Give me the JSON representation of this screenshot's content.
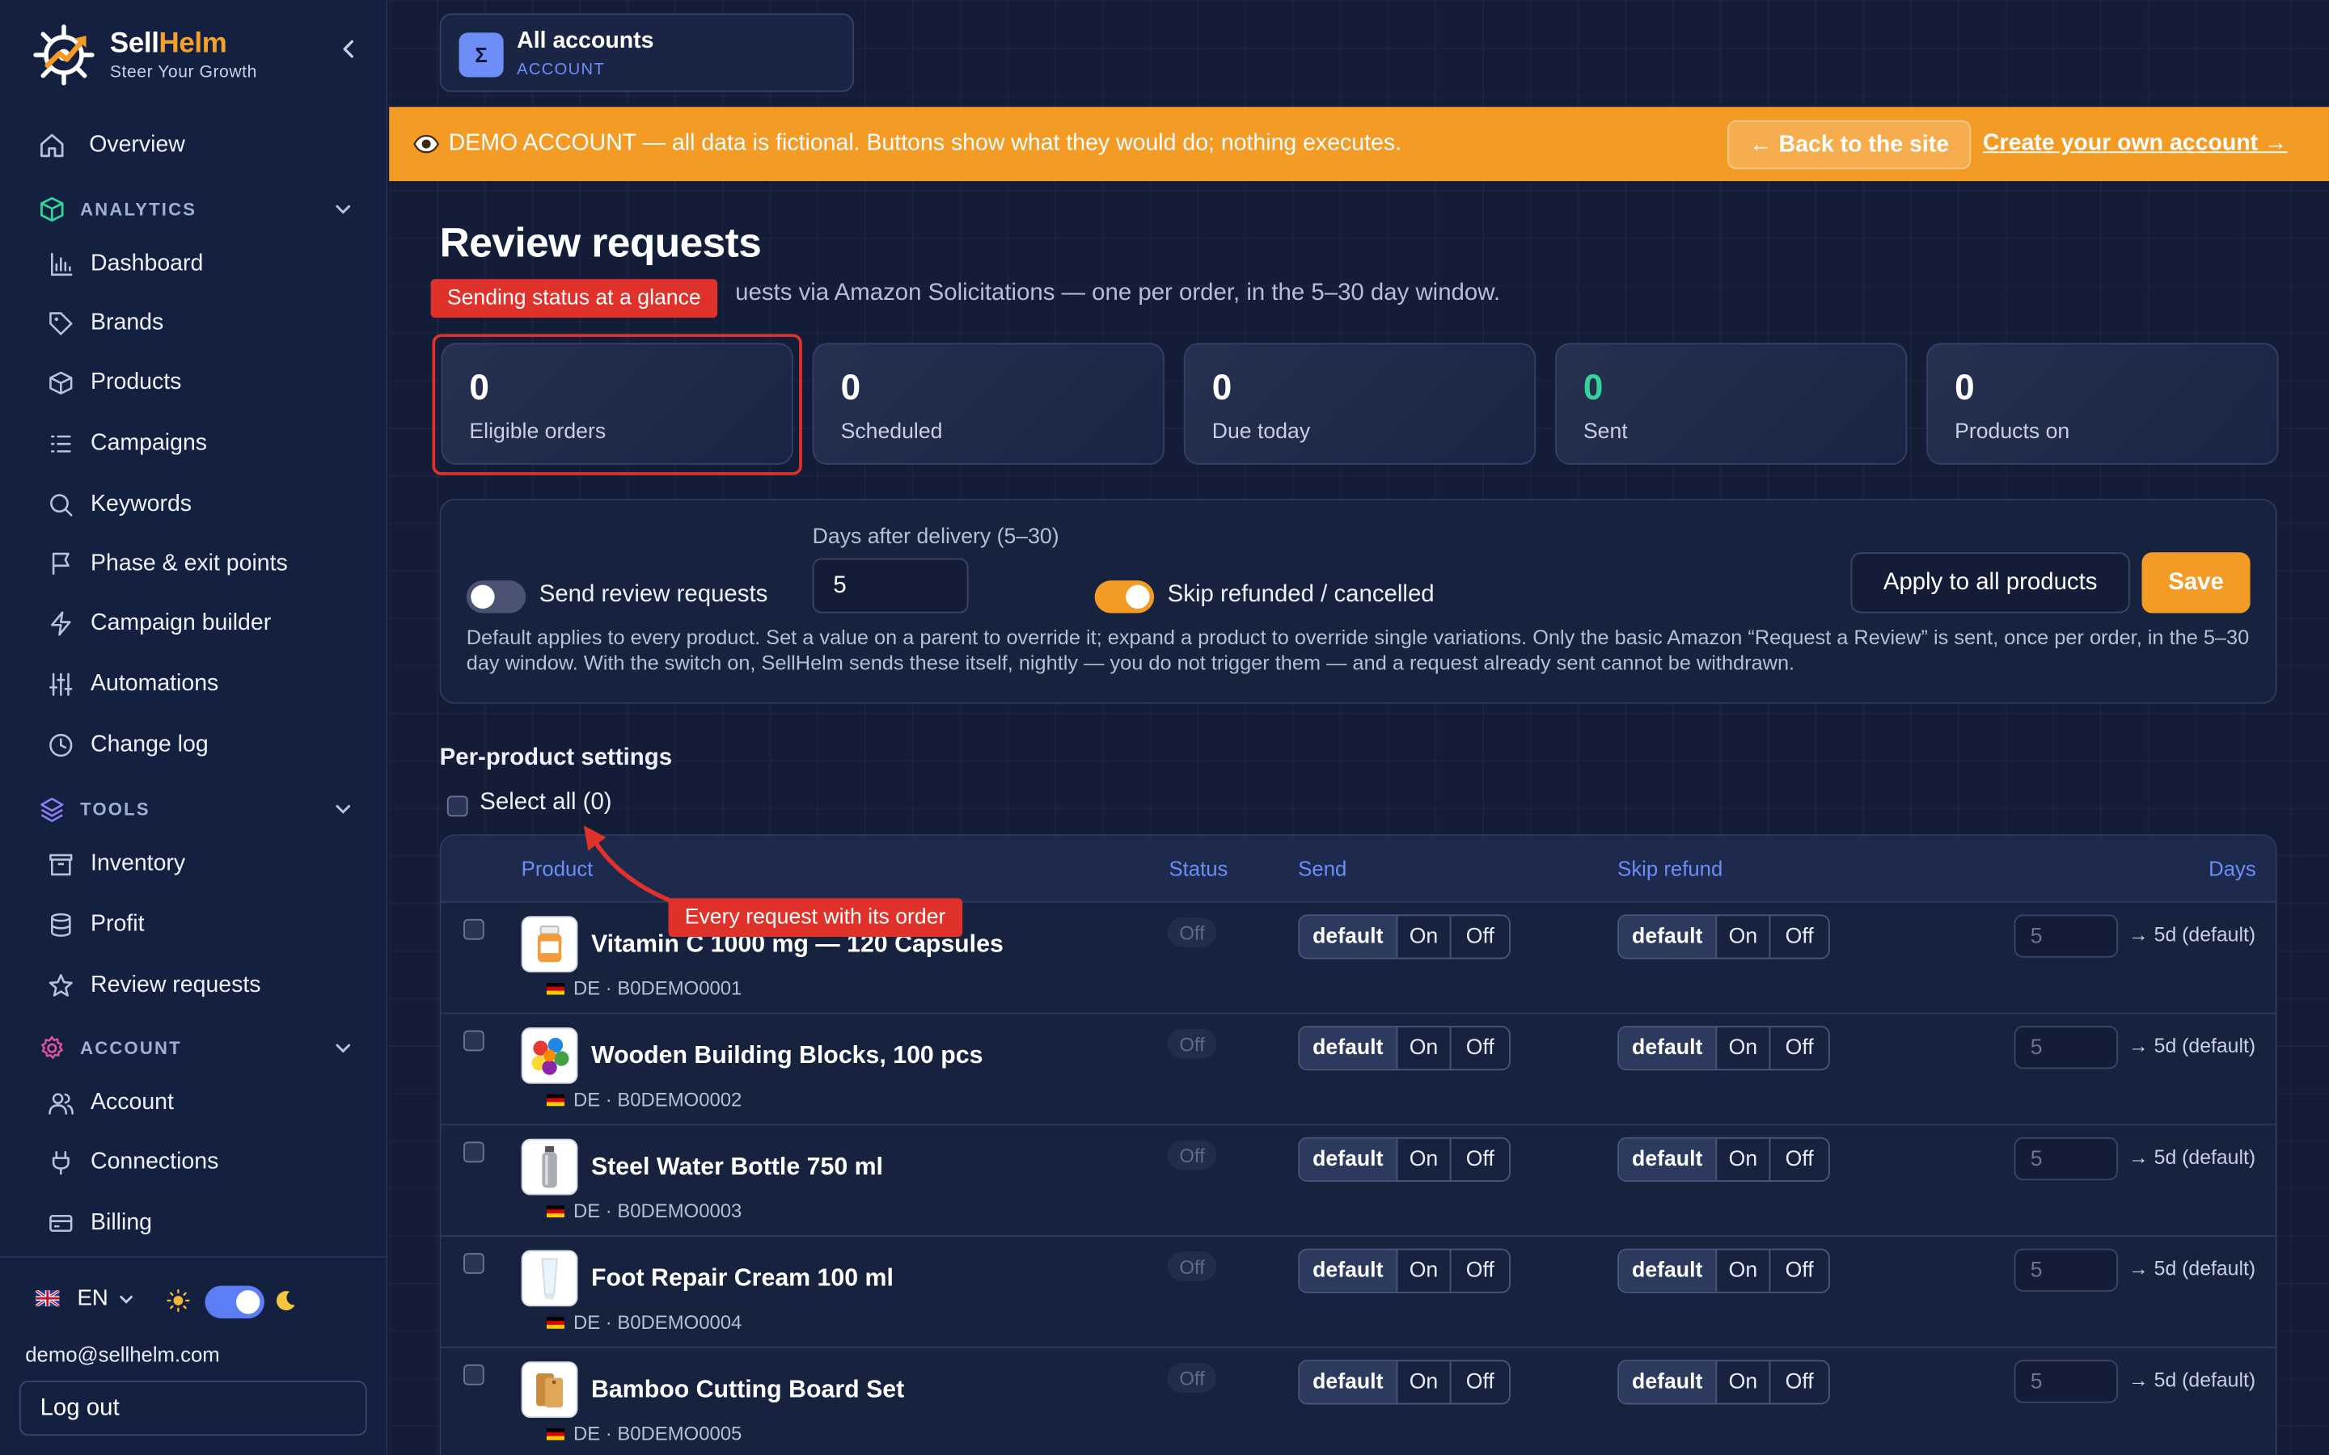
{
  "brand": {
    "name_part1": "Sell",
    "name_part2": "Helm",
    "tagline": "Steer Your Growth"
  },
  "sidebar": {
    "overview": "Overview",
    "analytics_section": "ANALYTICS",
    "analytics_items": [
      "Dashboard",
      "Brands",
      "Products",
      "Campaigns",
      "Keywords",
      "Phase & exit points",
      "Campaign builder",
      "Automations",
      "Change log"
    ],
    "tools_section": "TOOLS",
    "tools_items": [
      "Inventory",
      "Profit",
      "Review requests"
    ],
    "account_section": "ACCOUNT",
    "account_items": [
      "Account",
      "Connections",
      "Billing"
    ],
    "language": "EN",
    "user_email": "demo@sellhelm.com",
    "logout": "Log out"
  },
  "account_switcher": {
    "icon": "Σ",
    "title": "All accounts",
    "subtitle": "ACCOUNT"
  },
  "banner": {
    "message": "DEMO ACCOUNT — all data is fictional. Buttons show what they would do; nothing executes.",
    "back_label": "← Back to the site",
    "create_label": "Create your own account →"
  },
  "page": {
    "title": "Review requests",
    "subtitle_visible": "uests via Amazon Solicitations — one per order, in the 5–30 day window."
  },
  "tips": {
    "stats": "Sending status at a glance",
    "row_order": "Every request with its order"
  },
  "stats": [
    {
      "value": "0",
      "label": "Eligible orders"
    },
    {
      "value": "0",
      "label": "Scheduled"
    },
    {
      "value": "0",
      "label": "Due today"
    },
    {
      "value": "0",
      "label": "Sent"
    },
    {
      "value": "0",
      "label": "Products on"
    }
  ],
  "settings": {
    "send_label": "Send review requests",
    "send_enabled": false,
    "days_label": "Days after delivery (5–30)",
    "days_value": "5",
    "skip_label": "Skip refunded / cancelled",
    "skip_enabled": true,
    "apply_label": "Apply to all products",
    "save_label": "Save",
    "help": "Default applies to every product. Set a value on a parent to override it; expand a product to override single variations. Only the basic Amazon “Request a Review” is sent, once per order, in the 5–30 day window. With the switch on, SellHelm sends these itself, nightly — you do not trigger them — and a request already sent cannot be withdrawn."
  },
  "per_product": {
    "title": "Per-product settings",
    "select_all": "Select all (0)",
    "columns": {
      "product": "Product",
      "status": "Status",
      "send": "Send",
      "skip_refund": "Skip refund",
      "days": "Days"
    },
    "seg_labels": {
      "default": "default",
      "on": "On",
      "off": "Off"
    },
    "rows": [
      {
        "name": "Vitamin C 1000 mg — 120 Capsules",
        "meta": "DE · B0DEMO0001",
        "status": "Off",
        "days": "5",
        "days_hint": "→ 5d (default)"
      },
      {
        "name": "Wooden Building Blocks, 100 pcs",
        "meta": "DE · B0DEMO0002",
        "status": "Off",
        "days": "5",
        "days_hint": "→ 5d (default)"
      },
      {
        "name": "Steel Water Bottle 750 ml",
        "meta": "DE · B0DEMO0003",
        "status": "Off",
        "days": "5",
        "days_hint": "→ 5d (default)"
      },
      {
        "name": "Foot Repair Cream 100 ml",
        "meta": "DE · B0DEMO0004",
        "status": "Off",
        "days": "5",
        "days_hint": "→ 5d (default)"
      },
      {
        "name": "Bamboo Cutting Board Set",
        "meta": "DE · B0DEMO0005",
        "status": "Off",
        "days": "5",
        "days_hint": "→ 5d (default)"
      }
    ]
  },
  "colors": {
    "accent": "#f49b26",
    "primary": "#6d8ef7",
    "annotation": "#e0322b",
    "sent": "#35d39a"
  }
}
